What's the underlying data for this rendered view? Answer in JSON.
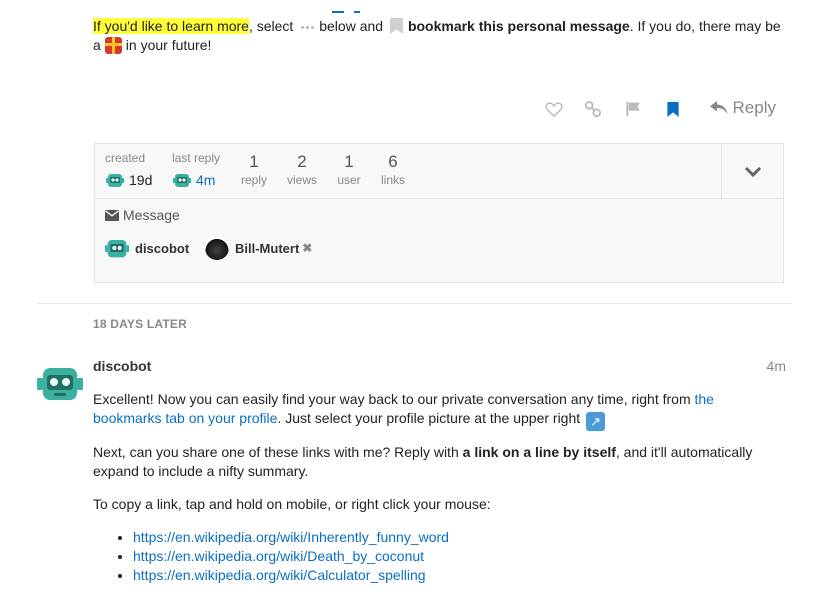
{
  "post1": {
    "highlight_text": "If you'd like to learn more",
    "text_after_highlight": ", select",
    "text_below_and": "below and",
    "bold_text": "bookmark this personal message",
    "text_after_bold": ". If you do, there may be",
    "text_a": "a",
    "text_future": "in your future!",
    "icons": [
      "more-dots-icon",
      "bookmark-icon",
      "gift-icon"
    ]
  },
  "actions": {
    "reply_label": "Reply",
    "icons": [
      "heart-icon",
      "link-icon",
      "flag-icon",
      "bookmark-icon",
      "reply-arrow-icon"
    ],
    "bookmark_color": "#0a6fc2"
  },
  "topic_map": {
    "created_label": "created",
    "created_value": "19d",
    "last_reply_label": "last reply",
    "last_reply_value": "4m",
    "stats": [
      {
        "value": "1",
        "label": "reply"
      },
      {
        "value": "2",
        "label": "views"
      },
      {
        "value": "1",
        "label": "user"
      },
      {
        "value": "6",
        "label": "links"
      }
    ],
    "message_label": "Message",
    "participants": [
      {
        "name": "discobot"
      },
      {
        "name": "Bill-Mutert",
        "remove": "✖"
      }
    ]
  },
  "small_action": "18 DAYS LATER",
  "post2": {
    "username": "discobot",
    "age": "4m",
    "p1_before_link": "Excellent! Now you can easily find your way back to our private conversation any time, right from",
    "p1_link": "the bookmarks tab on your profile",
    "p1_after_link": ". Just select your profile picture at the upper right",
    "p1_emoji": "↗",
    "p2_before_bold": "Next, can you share one of these links with me? Reply with",
    "p2_bold": "a link on a line by itself",
    "p2_after_bold": ", and it'll automatically expand to include a nifty summary.",
    "p3": "To copy a link, tap and hold on mobile, or right click your mouse:",
    "links": [
      "https://en.wikipedia.org/wiki/Inherently_funny_word",
      "https://en.wikipedia.org/wiki/Death_by_coconut",
      "https://en.wikipedia.org/wiki/Calculator_spelling"
    ]
  },
  "colors": {
    "link": "#0a6fc2",
    "highlight": "#ffff3b",
    "robot": "#3ab0a0"
  }
}
